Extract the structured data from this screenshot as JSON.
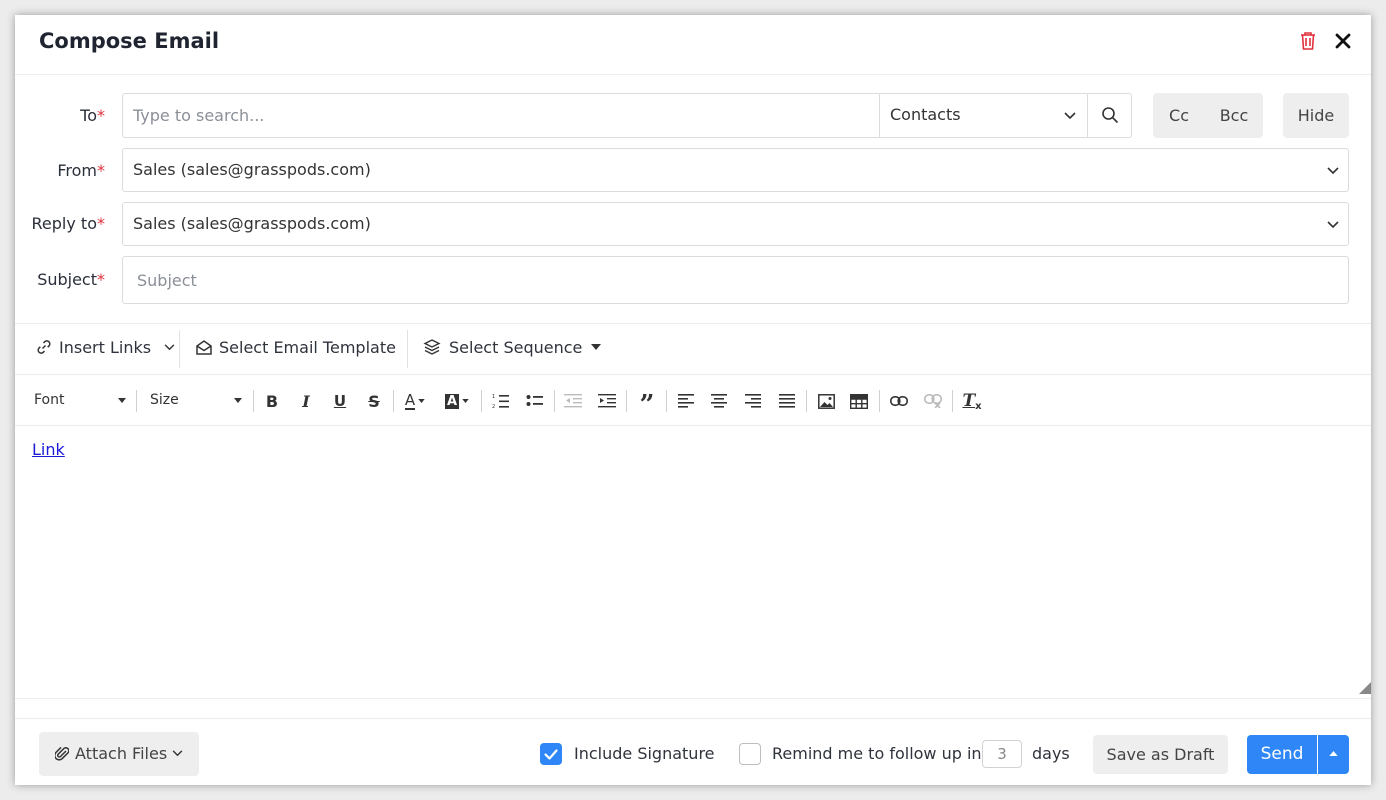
{
  "dialog": {
    "title": "Compose Email"
  },
  "form": {
    "to": {
      "label": "To",
      "required_mark": "*",
      "placeholder": "Type to search...",
      "source_select": "Contacts"
    },
    "cc_label": "Cc",
    "bcc_label": "Bcc",
    "hide_label": "Hide",
    "from": {
      "label": "From",
      "required_mark": "*",
      "value": "Sales (sales@grasspods.com)"
    },
    "reply_to": {
      "label": "Reply to",
      "required_mark": "*",
      "value": "Sales (sales@grasspods.com)"
    },
    "subject": {
      "label": "Subject",
      "required_mark": "*",
      "placeholder": "Subject"
    }
  },
  "insert_toolbar": {
    "insert_links": "Insert Links",
    "select_template": "Select Email Template",
    "select_sequence": "Select Sequence"
  },
  "format_toolbar": {
    "font_label": "Font",
    "size_label": "Size",
    "icons": [
      "bold-icon",
      "italic-icon",
      "underline-icon",
      "strikethrough-icon",
      "text-color-icon",
      "background-color-icon",
      "numbered-list-icon",
      "bulleted-list-icon",
      "decrease-indent-icon",
      "increase-indent-icon",
      "blockquote-icon",
      "align-left-icon",
      "align-center-icon",
      "align-right-icon",
      "justify-icon",
      "image-icon",
      "table-icon",
      "link-icon",
      "unlink-icon",
      "remove-format-icon"
    ]
  },
  "editor": {
    "link_text": "Link"
  },
  "footer": {
    "attach_label": "Attach Files",
    "include_signature_label": "Include Signature",
    "include_signature_checked": true,
    "remind_label": "Remind me to follow up in",
    "remind_checked": false,
    "remind_days": "3",
    "days_label": "days",
    "save_draft_label": "Save as Draft",
    "send_label": "Send"
  },
  "colors": {
    "accent": "#2f86f6",
    "required": "#e0323c",
    "trash": "#e0323c",
    "link": "#1a1ad8"
  }
}
